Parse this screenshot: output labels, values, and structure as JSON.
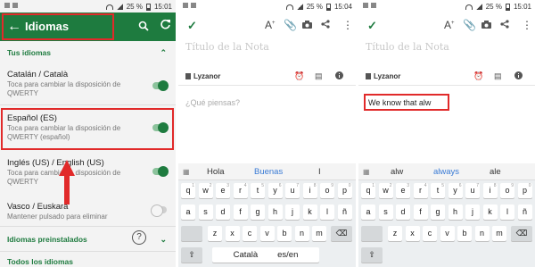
{
  "status": {
    "time1": "15:01",
    "time2": "15:04",
    "time3": "15:01",
    "battery": "25 %"
  },
  "panel1": {
    "title": "Idiomas",
    "section_your": "Tus idiomas",
    "languages": [
      {
        "name": "Catalán / Català",
        "sub": "Toca para cambiar la disposición de QWERTY",
        "on": true
      },
      {
        "name": "Español (ES)",
        "sub": "Toca para cambiar la disposición de QWERTY (español)",
        "on": true
      },
      {
        "name": "Inglés (US) / English (US)",
        "sub": "Toca para cambiar la disposición de QWERTY",
        "on": true
      },
      {
        "name": "Vasco / Euskara",
        "sub": "Mantener pulsado para eliminar",
        "on": false
      }
    ],
    "section_preinstalled": "Idiomas preinstalados",
    "section_all": "Todos los idiomas",
    "help_icon": "?"
  },
  "note": {
    "title_placeholder": "Título de la Nota",
    "owner": "Lyzanor",
    "body_placeholder": "¿Qué piensas?",
    "body_typed": "We know that alw"
  },
  "keyboard2": {
    "suggestions": [
      "Hola",
      "Buenas",
      "I"
    ],
    "space_left": "Català",
    "space_right": "es/en"
  },
  "keyboard3": {
    "suggestions": [
      "alw",
      "always",
      "ale"
    ]
  },
  "keys": {
    "row1": [
      "q",
      "w",
      "e",
      "r",
      "t",
      "y",
      "u",
      "i",
      "o",
      "p"
    ],
    "row1_sup": [
      "1",
      "2",
      "3",
      "4",
      "5",
      "6",
      "7",
      "8",
      "9",
      "0"
    ],
    "row2": [
      "a",
      "s",
      "d",
      "f",
      "g",
      "h",
      "j",
      "k",
      "l",
      "ñ"
    ],
    "row3": [
      "z",
      "x",
      "c",
      "v",
      "b",
      "n",
      "m"
    ]
  },
  "colors": {
    "green": "#1e7b3f",
    "highlight": "#e12a2a",
    "suggestion_mid": "#3a7bd5"
  }
}
